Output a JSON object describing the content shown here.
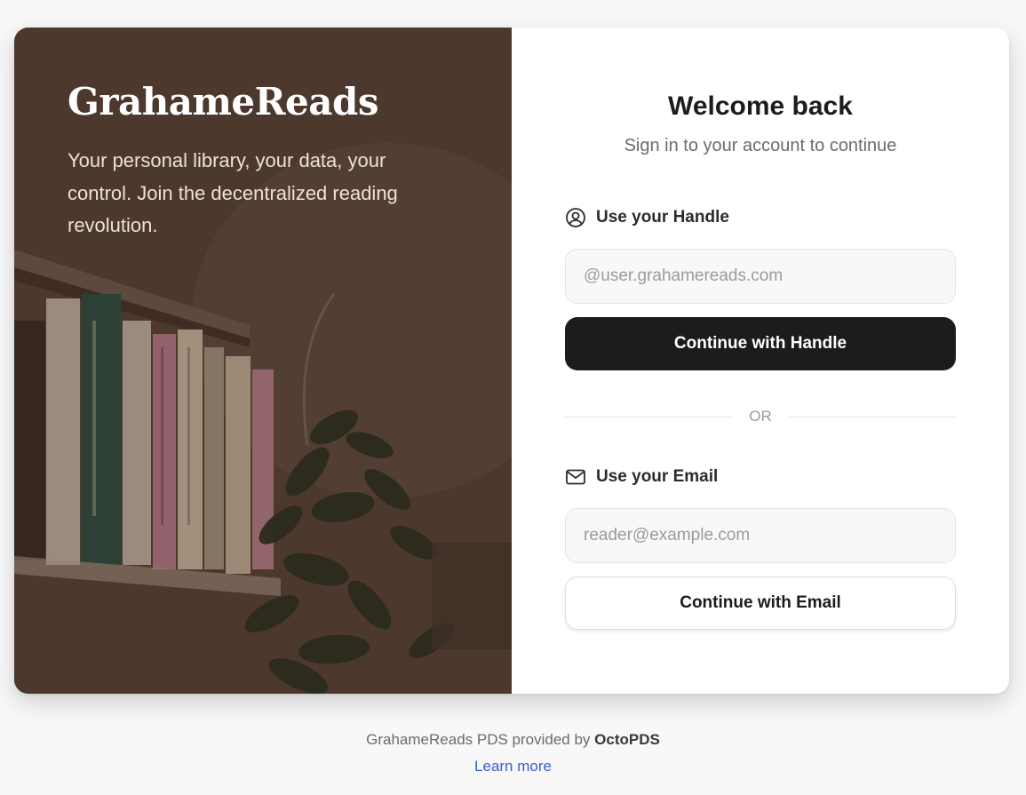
{
  "hero": {
    "brand": "GrahameReads",
    "tagline": "Your personal library, your data, your control. Join the decentralized reading revolution."
  },
  "signin": {
    "title": "Welcome back",
    "subtitle": "Sign in to your account to continue",
    "handle": {
      "label": "Use your Handle",
      "icon": "user-circle-icon",
      "placeholder": "@user.grahamereads.com",
      "button": "Continue with Handle"
    },
    "divider": "OR",
    "email": {
      "label": "Use your Email",
      "icon": "mail-icon",
      "placeholder": "reader@example.com",
      "button": "Continue with Email"
    }
  },
  "footer": {
    "prefix": "GrahameReads PDS provided by",
    "provider": "OctoPDS",
    "link": "Learn more"
  },
  "colors": {
    "primary_button": "#1c1c1e",
    "page_background": "#f8f8f8",
    "link": "#3b5bdb"
  }
}
